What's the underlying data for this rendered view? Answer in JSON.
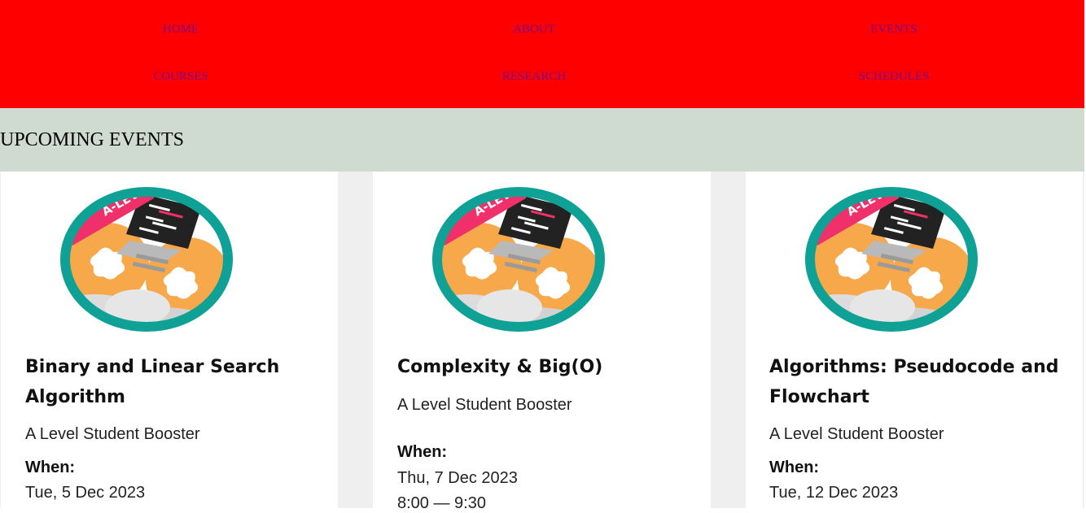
{
  "nav": {
    "items": [
      {
        "label": "HOME"
      },
      {
        "label": "ABOUT"
      },
      {
        "label": "EVENTS"
      },
      {
        "label": "COURSES"
      },
      {
        "label": "RESEARCH"
      },
      {
        "label": "SCHEDULES"
      }
    ]
  },
  "events_section": {
    "heading": "UPCOMING EVENTS"
  },
  "cards": [
    {
      "badge_text": "A-LEVEL",
      "title": "Binary and Linear Search Algorithm",
      "subtitle": "A Level Student Booster",
      "when_label": "When:",
      "date": "Tue, 5 Dec 2023"
    },
    {
      "badge_text": "A-LEVEL",
      "title": "Complexity & Big(O)",
      "subtitle": "A Level Student Booster",
      "when_label": "When:",
      "date": "Thu, 7 Dec 2023",
      "time": "8:00 — 9:30"
    },
    {
      "badge_text": "A-LEVEL",
      "title": "Algorithms: Pseudocode and Flowchart",
      "subtitle": "A Level Student Booster",
      "when_label": "When:",
      "date": "Tue, 12 Dec 2023"
    }
  ],
  "colors": {
    "nav_bg": "#ff0000",
    "nav_link": "#7a0a8e",
    "section_bg": "#cfdbd0",
    "badge_ring": "#0fa195",
    "badge_ribbon": "#f0306a",
    "badge_orange": "#f6a84a"
  }
}
